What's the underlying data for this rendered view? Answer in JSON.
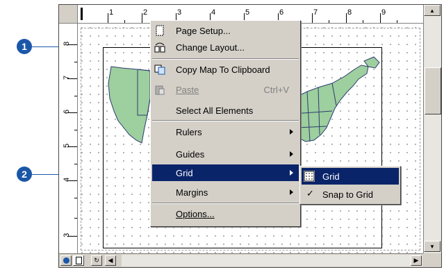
{
  "callouts": [
    "1",
    "2"
  ],
  "rulers": {
    "horizontal": [
      "1",
      "2",
      "3",
      "4",
      "5",
      "6",
      "7",
      "8",
      "9"
    ],
    "vertical": [
      "8",
      "7",
      "6",
      "5",
      "4",
      "3"
    ]
  },
  "context_menu": {
    "items": [
      {
        "label": "Page Setup...",
        "icon": "page-setup-icon"
      },
      {
        "label": "Change Layout...",
        "icon": "change-layout-icon"
      },
      {
        "label": "Copy Map To Clipboard",
        "icon": "copy-map-icon"
      },
      {
        "label": "Paste",
        "shortcut": "Ctrl+V",
        "icon": "paste-icon",
        "disabled": true
      },
      {
        "label": "Select All Elements"
      },
      {
        "label": "Rulers",
        "submenu": true
      },
      {
        "label": "Guides",
        "submenu": true
      },
      {
        "label": "Grid",
        "submenu": true,
        "selected": true
      },
      {
        "label": "Margins",
        "submenu": true
      },
      {
        "label": "Options..."
      }
    ]
  },
  "grid_submenu": {
    "items": [
      {
        "label": "Grid",
        "icon": "grid-icon",
        "selected": true
      },
      {
        "label": "Snap to Grid",
        "checked": true
      }
    ]
  },
  "colors": {
    "menu_highlight": "#0a246a",
    "map_fill": "#9dcf9f",
    "callout": "#1b57a8"
  }
}
